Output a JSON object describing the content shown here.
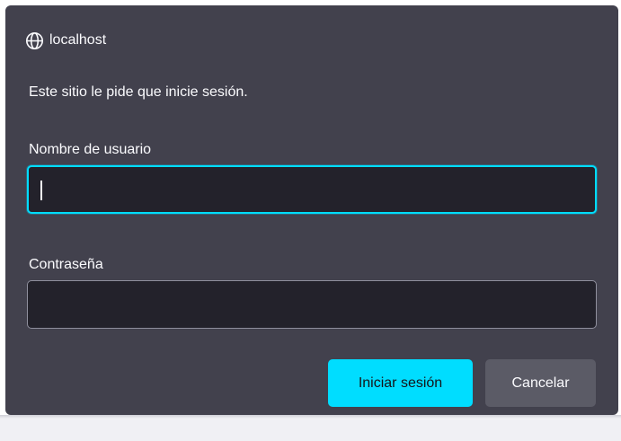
{
  "dialog": {
    "host": "localhost",
    "message": "Este sitio le pide que inicie sesión.",
    "username": {
      "label": "Nombre de usuario",
      "value": ""
    },
    "password": {
      "label": "Contraseña",
      "value": ""
    },
    "buttons": {
      "sign_in": "Iniciar sesión",
      "cancel": "Cancelar"
    }
  },
  "colors": {
    "dialog_background": "#42414d",
    "input_background": "#23222b",
    "accent": "#00ddff",
    "secondary_button": "#5b5b66",
    "text": "#fbfbfe"
  },
  "icons": {
    "host": "globe-icon"
  }
}
